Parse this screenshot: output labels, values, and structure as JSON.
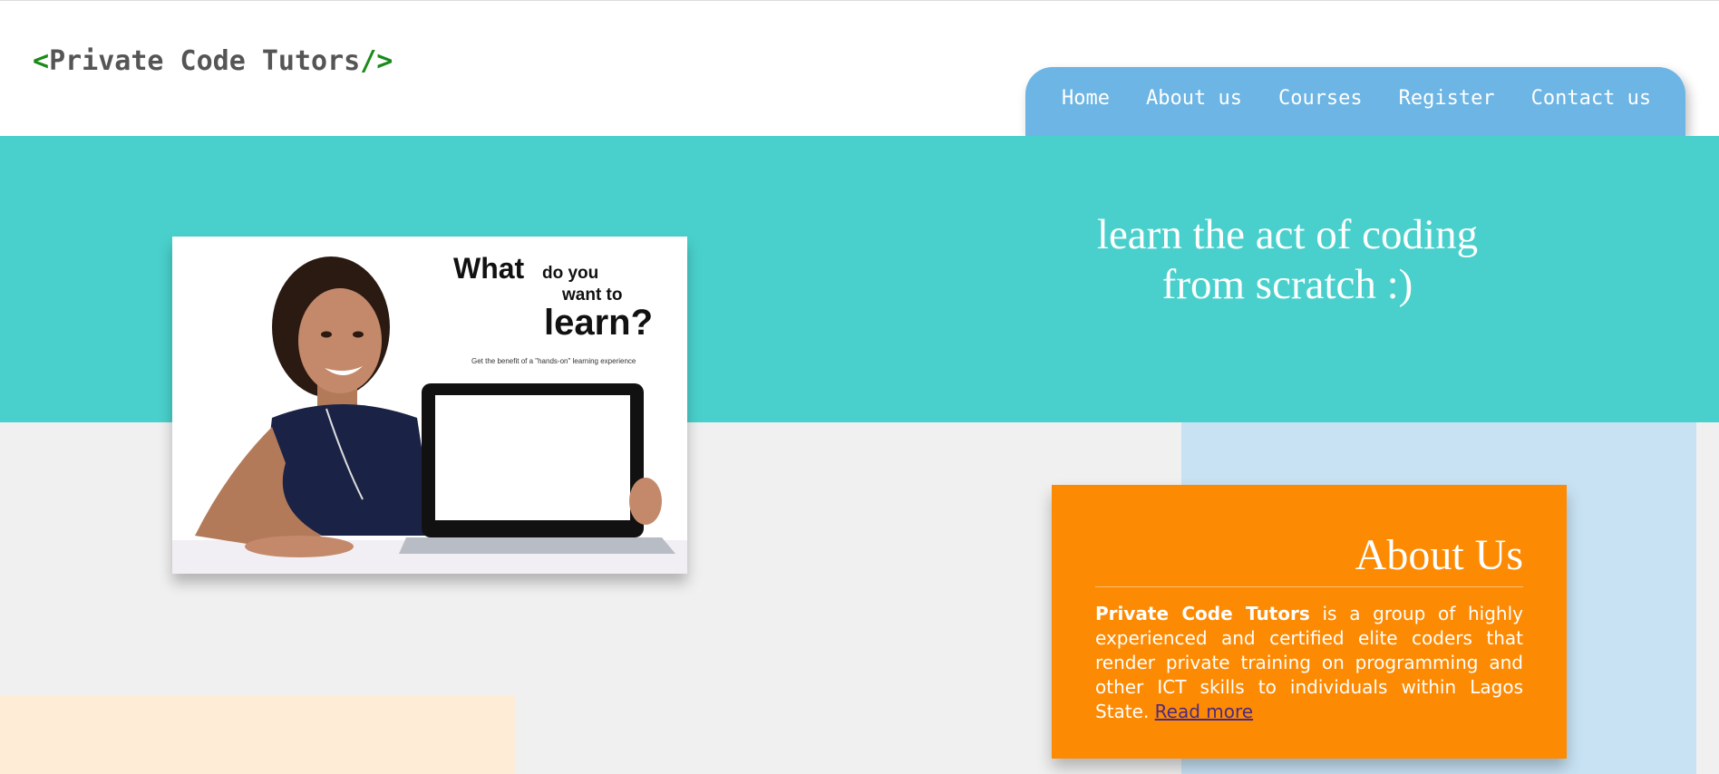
{
  "logo": {
    "open_bracket": "<",
    "name": "Private Code Tutors",
    "close_slash": "/",
    "close_bracket": ">"
  },
  "nav": {
    "items": [
      {
        "label": "Home"
      },
      {
        "label": "About us"
      },
      {
        "label": "Courses"
      },
      {
        "label": "Register"
      },
      {
        "label": "Contact us"
      }
    ]
  },
  "hero": {
    "tagline_line1": "learn the act of coding",
    "tagline_line2": "from scratch :)",
    "image": {
      "heading_big": "What",
      "heading_small": "do you",
      "heading_line2": "want to",
      "heading_line3": "learn?",
      "caption": "Get the benefit of a \"hands-on\" learning experience"
    }
  },
  "about": {
    "title": "About Us",
    "brand": "Private Code Tutors",
    "body": " is a group of highly experienced and certified elite coders that render private training on programming and other ICT skills to individuals within Lagos State. ",
    "read_more": "Read more"
  },
  "colors": {
    "hero_bg": "#4ad0cc",
    "nav_bg": "#6db5e4",
    "about_bg": "#fd8a03",
    "page_bg": "#f0f0f0",
    "light_blue_panel": "#c8e2f4",
    "peach_panel": "#feecd7",
    "logo_bracket": "#1a8a1a",
    "logo_text": "#555555"
  }
}
